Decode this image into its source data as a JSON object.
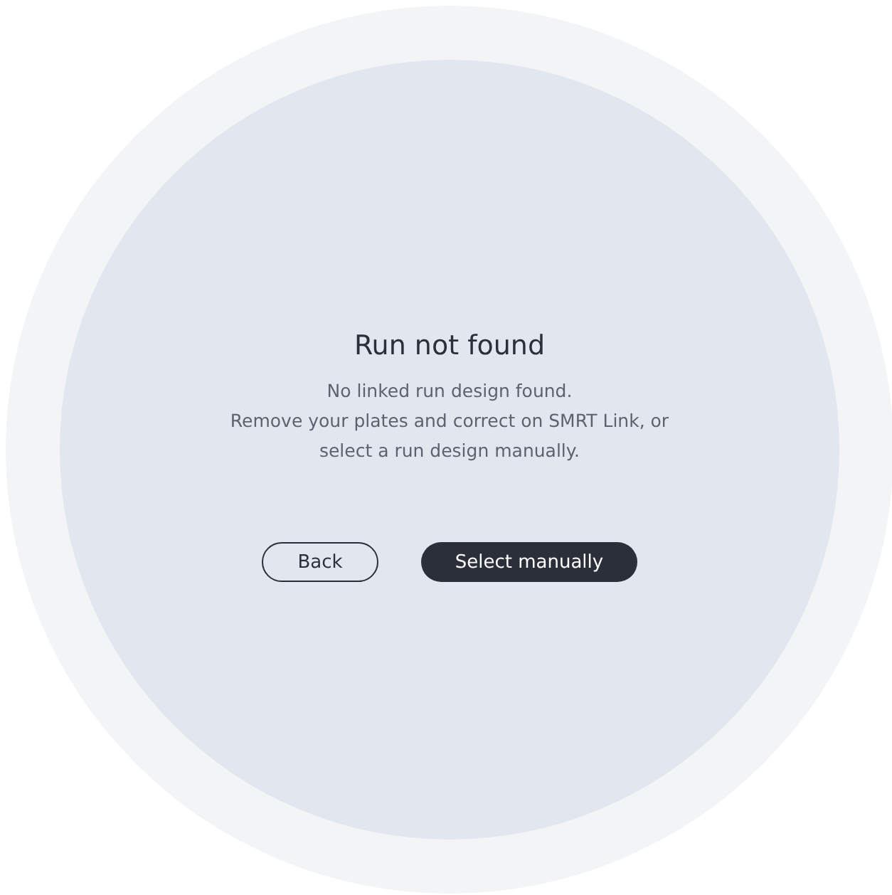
{
  "dialog": {
    "title": "Run not found",
    "message": [
      "No linked run design found.",
      "Remove your plates and correct on SMRT Link, or",
      "select a run design manually."
    ]
  },
  "buttons": [
    {
      "label": "Back",
      "kind": "secondary"
    },
    {
      "label": "Select manually",
      "kind": "primary"
    }
  ]
}
